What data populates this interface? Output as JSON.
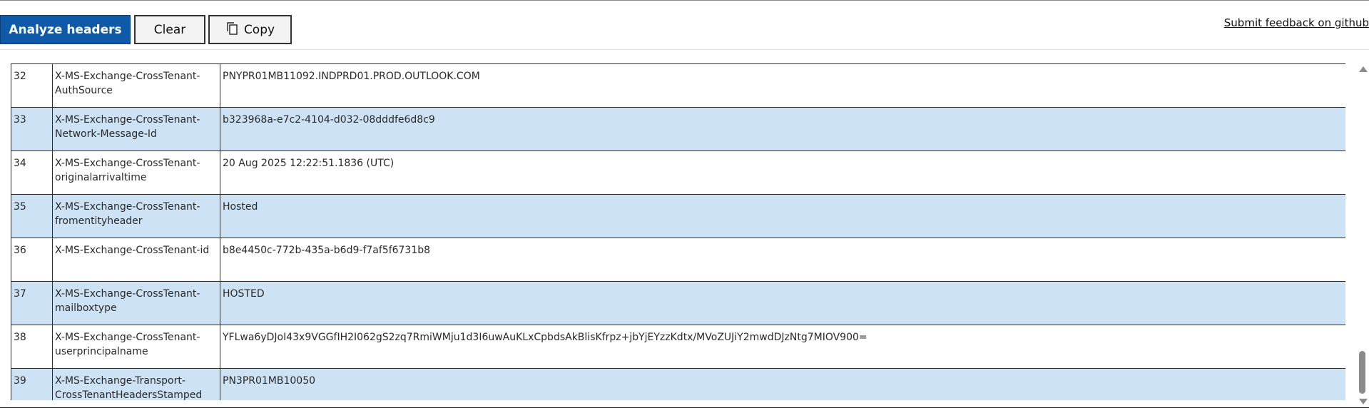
{
  "toolbar": {
    "analyze_label": "Analyze headers",
    "clear_label": "Clear",
    "copy_label": "Copy",
    "feedback_label": "Submit feedback on github"
  },
  "colors": {
    "primary": "#0f5aa8",
    "alt_row": "#cde3f5"
  },
  "table": {
    "rows": [
      {
        "num": "32",
        "name": "X-MS-Exchange-CrossTenant-AuthSource",
        "value": "PNYPR01MB11092.INDPRD01.PROD.OUTLOOK.COM"
      },
      {
        "num": "33",
        "name": "X-MS-Exchange-CrossTenant-Network-Message-Id",
        "value": "b323968a-e7c2-4104-d032-08dddfe6d8c9"
      },
      {
        "num": "34",
        "name": "X-MS-Exchange-CrossTenant-originalarrivaltime",
        "value": "20 Aug 2025 12:22:51.1836 (UTC)"
      },
      {
        "num": "35",
        "name": "X-MS-Exchange-CrossTenant-fromentityheader",
        "value": "Hosted"
      },
      {
        "num": "36",
        "name": "X-MS-Exchange-CrossTenant-id",
        "value": "b8e4450c-772b-435a-b6d9-f7af5f6731b8"
      },
      {
        "num": "37",
        "name": "X-MS-Exchange-CrossTenant-mailboxtype",
        "value": "HOSTED"
      },
      {
        "num": "38",
        "name": "X-MS-Exchange-CrossTenant-userprincipalname",
        "value": "YFLwa6yDJoI43x9VGGfIH2I062gS2zq7RmiWMju1d3I6uwAuKLxCpbdsAkBlisKfrpz+jbYjEYzzKdtx/MVoZUJiY2mwdDJzNtg7MIOV900="
      },
      {
        "num": "39",
        "name": "X-MS-Exchange-Transport-CrossTenantHeadersStamped",
        "value": "PN3PR01MB10050"
      }
    ]
  }
}
